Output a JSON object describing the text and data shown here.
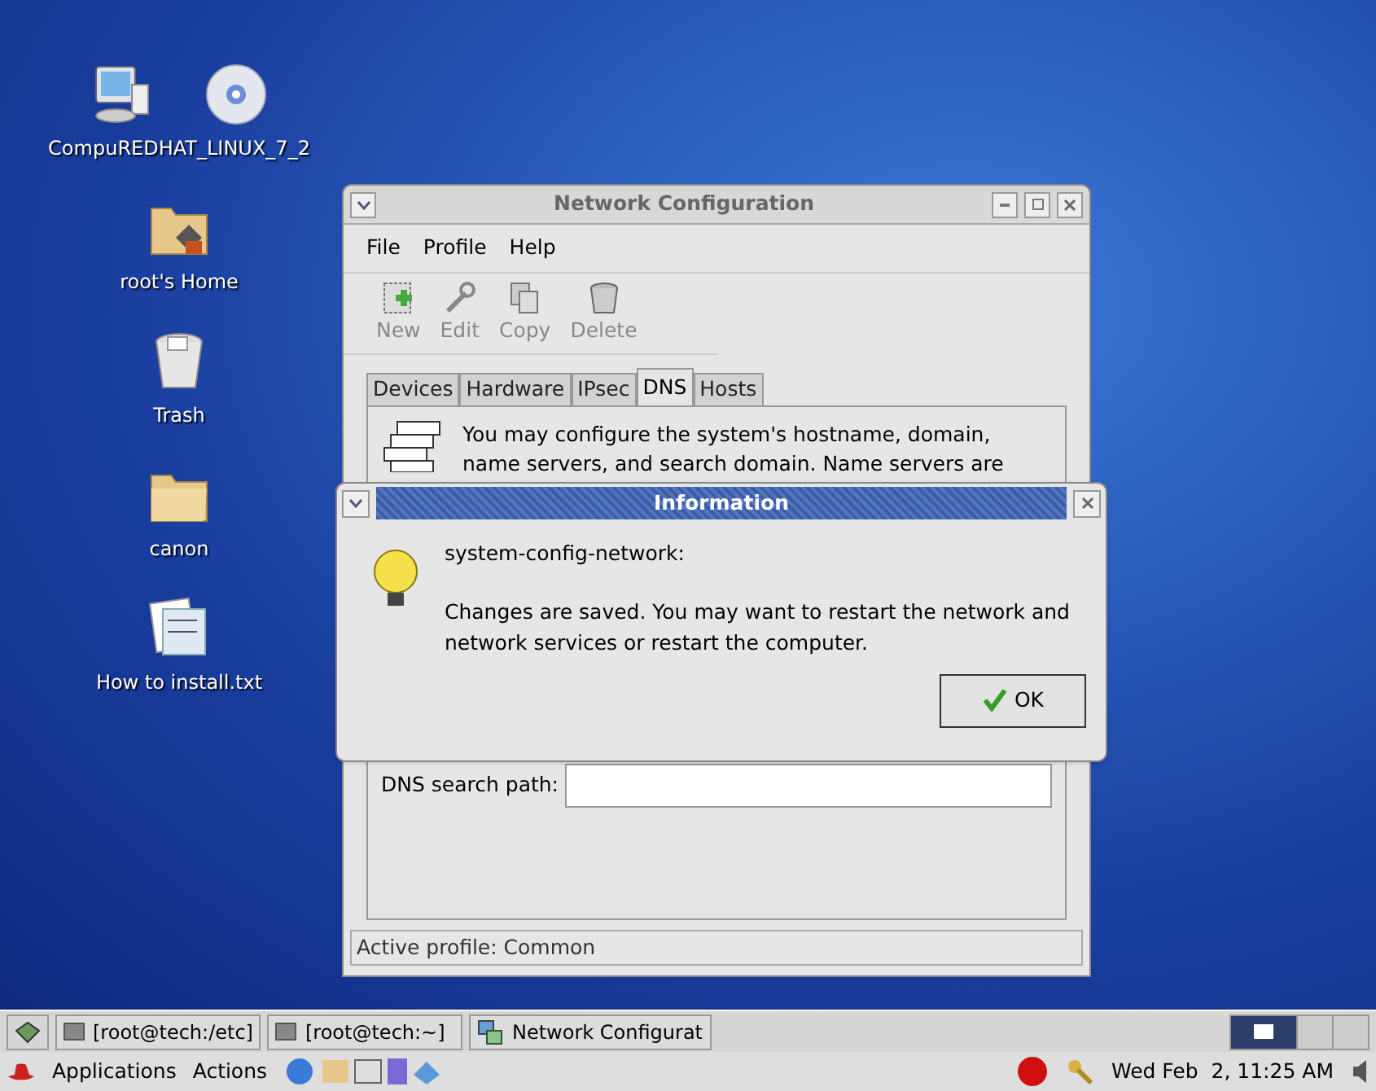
{
  "desktop_icons": [
    {
      "kind": "computer",
      "labels": [
        "Compu",
        "REDHAT_LINUX_7_2"
      ]
    },
    {
      "kind": "home",
      "labels": [
        "root's Home"
      ]
    },
    {
      "kind": "trash",
      "labels": [
        "Trash"
      ]
    },
    {
      "kind": "folder",
      "labels": [
        "canon"
      ]
    },
    {
      "kind": "textfile",
      "labels": [
        "How to install.txt"
      ]
    }
  ],
  "cdrom": {
    "kind": "cd"
  },
  "window": {
    "title": "Network Configuration",
    "menu": [
      "File",
      "Profile",
      "Help"
    ],
    "toolbar": [
      {
        "kind": "new",
        "label": "New"
      },
      {
        "kind": "edit",
        "label": "Edit"
      },
      {
        "kind": "copy",
        "label": "Copy"
      },
      {
        "kind": "delete",
        "label": "Delete"
      }
    ],
    "tabs": [
      {
        "label": "Devices",
        "selected": false
      },
      {
        "label": "Hardware",
        "selected": false
      },
      {
        "label": "IPsec",
        "selected": false
      },
      {
        "label": "DNS",
        "selected": true
      },
      {
        "label": "Hosts",
        "selected": false
      }
    ],
    "description": [
      "You may configure the system's hostname, domain,",
      "name servers, and search domain. Name servers are"
    ],
    "search_path": {
      "label": "DNS search path:"
    },
    "status_bar": "Active profile: Common"
  },
  "dialog": {
    "title": "Information",
    "source": "system-config-network:",
    "message": "Changes are saved. You may want to restart the network and network services or restart the computer.",
    "button": "OK"
  },
  "taskbar": {
    "windows": [
      {
        "label": "[root@tech:/etc]",
        "kind": "terminal"
      },
      {
        "label": "[root@tech:~]",
        "kind": "terminal"
      },
      {
        "label": "Network Configurat",
        "kind": "network"
      }
    ]
  },
  "panel": {
    "menus": [
      "Applications",
      "Actions"
    ],
    "clock": "Wed Feb  2, 11:25 AM"
  }
}
